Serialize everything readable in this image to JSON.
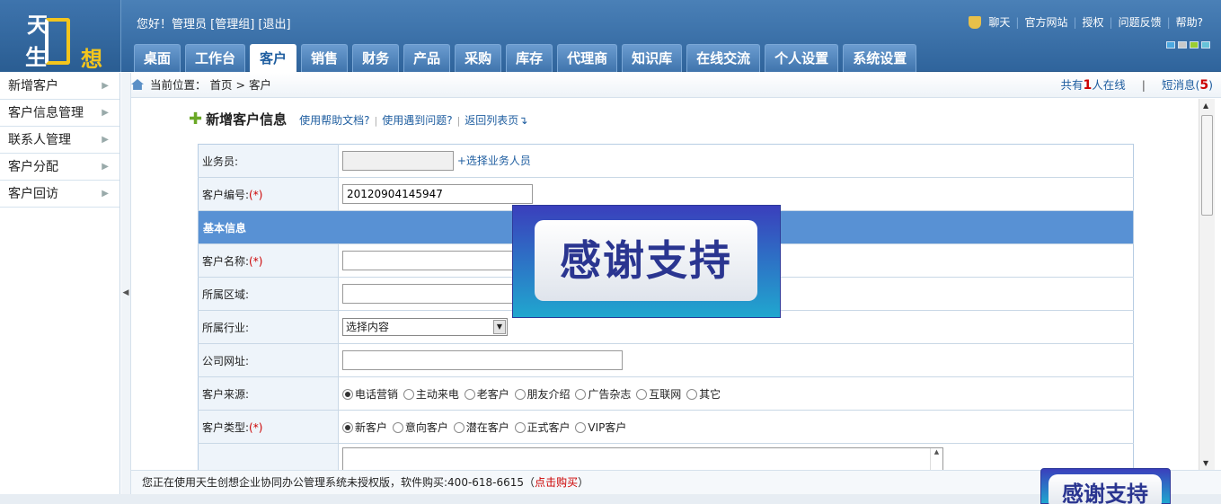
{
  "header": {
    "logo_chars": [
      "天",
      "生",
      "想"
    ],
    "greeting": "您好！管理员 [管理组] [退出]",
    "top_links": [
      "聊天",
      "官方网站",
      "授权",
      "问题反馈",
      "帮助?"
    ],
    "tabs": [
      "桌面",
      "工作台",
      "客户",
      "销售",
      "财务",
      "产品",
      "采购",
      "库存",
      "代理商",
      "知识库",
      "在线交流",
      "个人设置",
      "系统设置"
    ],
    "active_tab": "客户"
  },
  "sidebar": {
    "items": [
      {
        "label": "新增客户"
      },
      {
        "label": "客户信息管理"
      },
      {
        "label": "联系人管理"
      },
      {
        "label": "客户分配"
      },
      {
        "label": "客户回访"
      }
    ]
  },
  "breadcrumb": {
    "prefix": "当前位置：",
    "home": "首页",
    "sep": ">",
    "current": "客户",
    "online_prefix": "共有",
    "online_count": "1",
    "online_suffix": "人在线",
    "msg_label": "短消息(",
    "msg_count": "5",
    "msg_close": ")"
  },
  "form": {
    "title": "新增客户信息",
    "help_doc": "使用帮助文档?",
    "help_issue": "使用遇到问题?",
    "back": "返回列表页",
    "salesman_label": "业务员:",
    "salesman_link": "+选择业务人员",
    "code_label": "客户编号:",
    "required_mark": "(*)",
    "code_value": "20120904145947",
    "section_basic": "基本信息",
    "name_label": "客户名称:",
    "region_label": "所属区域:",
    "industry_label": "所属行业:",
    "industry_value": "选择内容",
    "website_label": "公司网址:",
    "source_label": "客户来源:",
    "source_options": [
      "电话营销",
      "主动来电",
      "老客户",
      "朋友介绍",
      "广告杂志",
      "互联网",
      "其它"
    ],
    "type_label": "客户类型:",
    "type_options": [
      "新客户",
      "意向客户",
      "潜在客户",
      "正式客户",
      "VIP客户"
    ]
  },
  "footer": {
    "text": "您正在使用天生创想企业协同办公管理系统未授权版，软件购买:400-618-6615（",
    "buy": "点击购买",
    "close": "）"
  },
  "overlay": {
    "text": "感谢支持"
  }
}
